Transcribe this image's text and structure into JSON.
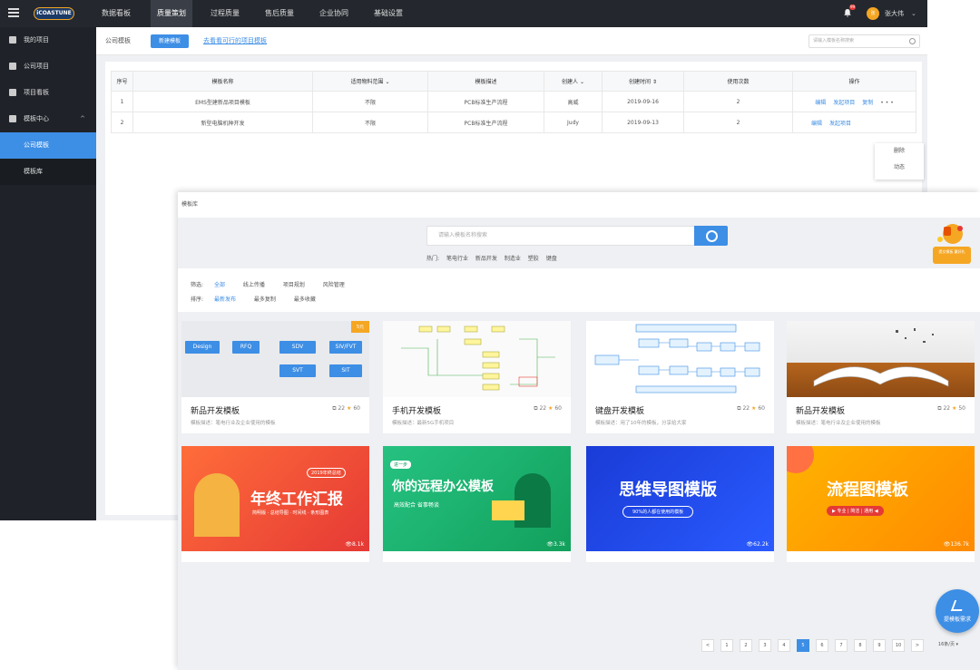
{
  "topbar": {
    "logo": "iCOASTUNE",
    "nav": [
      "数据看板",
      "质量策划",
      "过程质量",
      "售后质量",
      "企业协同",
      "基础设置"
    ],
    "active_nav": "质量策划",
    "badge": "99",
    "user": "张大伟"
  },
  "sidebar": {
    "items": [
      {
        "label": "我的项目"
      },
      {
        "label": "公司项目"
      },
      {
        "label": "项目看板"
      },
      {
        "label": "模板中心"
      },
      {
        "label": "公司模板"
      },
      {
        "label": "模板库"
      }
    ]
  },
  "toolbar": {
    "crumb": "公司模板",
    "new_label": "新建模板",
    "link": "去看看可行的项目模板",
    "search_placeholder": "请输入模板名称搜索"
  },
  "table": {
    "headers": [
      "序号",
      "模板名称",
      "适用物料范围",
      "模板描述",
      "创建人",
      "创建时间",
      "使用次数",
      "操作"
    ],
    "rows": [
      {
        "no": "1",
        "name": "EMS型建新品项目模板",
        "scope": "不限",
        "desc": "PCB标准生产流程",
        "creator": "高威",
        "time": "2019-09-16",
        "count": "2"
      },
      {
        "no": "2",
        "name": "新型电脑机种开发",
        "scope": "不限",
        "desc": "PCB标准生产流程",
        "creator": "Judy",
        "time": "2019-09-13",
        "count": "2"
      }
    ],
    "ops": [
      "编辑",
      "发起项目",
      "复制"
    ],
    "more": "• • •",
    "menu": [
      "删除",
      "动态"
    ]
  },
  "library": {
    "head": "模板库",
    "search_placeholder": "请输入模板名称搜索",
    "hot_label": "热门:",
    "hot": [
      "笔电行业",
      "新品开发",
      "制造业",
      "塑胶",
      "键盘"
    ],
    "promo": "提交模板 赢好礼",
    "filter_label": "筛选:",
    "filters": [
      "全部",
      "线上传播",
      "项目规划",
      "风险管理"
    ],
    "sort_label": "排序:",
    "sorts": [
      "最新发布",
      "最多复制",
      "最多收藏"
    ],
    "cards": [
      {
        "title": "新品开发模板",
        "copies": "22",
        "stars": "60",
        "desc": "模板描述：笔电行业及企业使用的模板",
        "tag": "5元",
        "nodes": [
          "Design",
          "RFQ",
          "SDV",
          "SIV/FVT",
          "SVT",
          "SIT"
        ]
      },
      {
        "title": "手机开发模板",
        "copies": "22",
        "stars": "60",
        "desc": "模板描述：最新5G手机项目"
      },
      {
        "title": "键盘开发模板",
        "copies": "22",
        "stars": "60",
        "desc": "模板描述：用了10年的模板，分享给大家"
      },
      {
        "title": "新品开发模板",
        "copies": "22",
        "stars": "50",
        "desc": "模板描述：笔电行业及企业使用的模板"
      }
    ],
    "banners": [
      {
        "text": "年终工作汇报",
        "sub": "2019年终总结",
        "tags": "简明版 · 总结导图 · 时间线 · 条形图表",
        "views": "8.1k"
      },
      {
        "text": "你的远程办公模板",
        "sub": "高效配合  省事畅谈",
        "tag": "进一步",
        "views": "3.3k"
      },
      {
        "text": "思维导图模版",
        "sub": "90%的人都在使用的模板",
        "views": "62.2k"
      },
      {
        "text": "流程图模板",
        "sub": "▶ 专业 | 简洁 | 通用 ◀",
        "views": "136.7k"
      }
    ],
    "pages": [
      "<",
      "1",
      "2",
      "3",
      "4",
      "5",
      "6",
      "7",
      "8",
      "9",
      "10",
      ">"
    ],
    "current_page": "5",
    "per_page": "16条/页",
    "fab": "提模板需求"
  }
}
